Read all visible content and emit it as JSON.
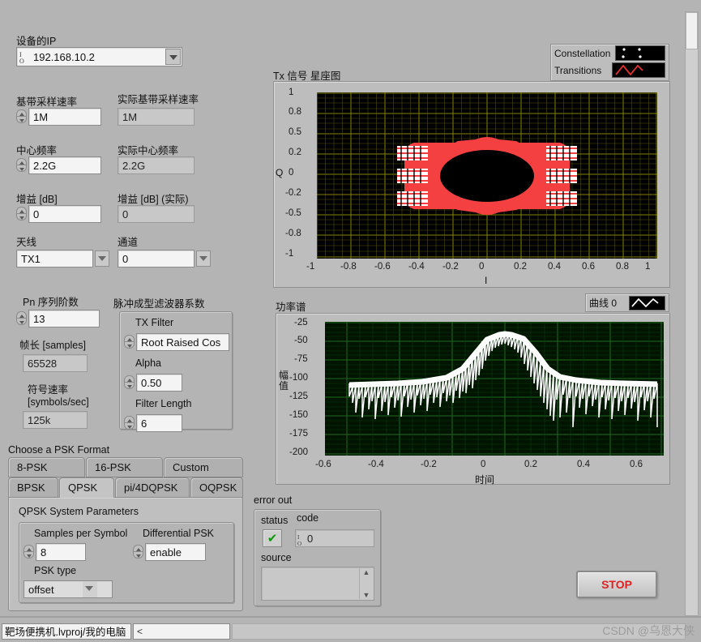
{
  "device": {
    "ip_label": "设备的IP",
    "ip_value": "192.168.10.2"
  },
  "rates": {
    "baseband_label": "基带采样速率",
    "baseband_value": "1M",
    "actual_baseband_label": "实际基带采样速率",
    "actual_baseband_value": "1M",
    "center_freq_label": "中心频率",
    "center_freq_value": "2.2G",
    "actual_center_freq_label": "实际中心频率",
    "actual_center_freq_value": "2.2G",
    "gain_label": "增益 [dB]",
    "gain_value": "0",
    "actual_gain_label": "增益 [dB] (实际)",
    "actual_gain_value": "0",
    "antenna_label": "天线",
    "antenna_value": "TX1",
    "channel_label": "通道",
    "channel_value": "0"
  },
  "pn": {
    "order_label": "Pn 序列阶数",
    "order_value": "13",
    "frame_label": "帧长 [samples]",
    "frame_value": "65528",
    "symbol_rate_label_1": "符号速率",
    "symbol_rate_label_2": "[symbols/sec]",
    "symbol_rate_value": "125k"
  },
  "pulse_shaping": {
    "group_label": "脉冲成型滤波器系数",
    "tx_filter_label": "TX Filter",
    "tx_filter_value": "Root Raised Cos",
    "alpha_label": "Alpha",
    "alpha_value": "0.50",
    "filter_length_label": "Filter Length",
    "filter_length_value": "6"
  },
  "psk": {
    "section_label": "Choose a PSK Format",
    "tabs_row1": [
      "8-PSK",
      "16-PSK",
      "Custom"
    ],
    "tabs_row2": [
      "BPSK",
      "QPSK",
      "pi/4DQPSK",
      "OQPSK"
    ],
    "active_tab": "QPSK",
    "params_title": "QPSK System Parameters",
    "samples_per_symbol_label": "Samples per Symbol",
    "samples_per_symbol_value": "8",
    "differential_label": "Differential PSK",
    "differential_value": "enable",
    "psk_type_label": "PSK type",
    "psk_type_value": "offset"
  },
  "constellation": {
    "title": "Tx 信号 星座图",
    "xlabel": "I",
    "ylabel": "Q",
    "legend": [
      {
        "name": "Constellation",
        "icon": "dots-swatch"
      },
      {
        "name": "Transitions",
        "icon": "zigzag-swatch"
      }
    ],
    "grid_color": "#8a8a00",
    "trace_color": "#f44040",
    "point_color": "#ffffff"
  },
  "spectrum": {
    "title": "功率谱",
    "xlabel": "时间",
    "ylabel": "幅值",
    "legend_label": "曲线 0",
    "grid_color": "#1f6b1f",
    "trace_color": "#ffffff"
  },
  "error_out": {
    "title": "error out",
    "status_label": "status",
    "status_icon": "check-mark",
    "code_label": "code",
    "code_value": "0",
    "source_label": "source",
    "source_value": ""
  },
  "stop": {
    "label": "STOP",
    "color": "#e02020"
  },
  "statusbar": {
    "project": "靶场便携机.lvproj/我的电脑",
    "watermark": "CSDN @乌恩大侠"
  },
  "chart_data": [
    {
      "type": "scatter",
      "title": "Tx 信号 星座图",
      "xlabel": "I",
      "ylabel": "Q",
      "xlim": [
        -1.0,
        1.0
      ],
      "ylim": [
        -1.0,
        1.0
      ],
      "xticks": [
        -1.0,
        -0.8,
        -0.6,
        -0.4,
        -0.2,
        0.0,
        0.2,
        0.4,
        0.6,
        0.8,
        1.0
      ],
      "yticks": [
        1.0,
        0.8,
        0.5,
        0.2,
        0.0,
        -0.2,
        -0.5,
        -0.8,
        -1.0
      ],
      "grid": true,
      "legend": [
        "Constellation",
        "Transitions"
      ],
      "series": [
        {
          "name": "Constellation",
          "points": [
            [
              -0.42,
              0.3
            ],
            [
              0.42,
              0.3
            ],
            [
              -0.42,
              0.0
            ],
            [
              0.42,
              0.0
            ],
            [
              -0.42,
              -0.3
            ],
            [
              0.42,
              -0.3
            ]
          ]
        },
        {
          "name": "Transitions",
          "description": "dense offset-QPSK trajectory ring between constellation clusters"
        }
      ]
    },
    {
      "type": "line",
      "title": "功率谱",
      "xlabel": "时间",
      "ylabel": "幅值",
      "xlim": [
        -0.7,
        0.7
      ],
      "ylim": [
        -200,
        -25
      ],
      "xticks": [
        -0.6,
        -0.4,
        -0.2,
        0,
        0.2,
        0.4,
        0.6
      ],
      "yticks": [
        -25,
        -50,
        -75,
        -100,
        -125,
        -150,
        -175,
        -200
      ],
      "grid": true,
      "legend": [
        "曲线 0"
      ],
      "series": [
        {
          "name": "曲线 0",
          "x": [
            -0.62,
            -0.55,
            -0.48,
            -0.4,
            -0.32,
            -0.24,
            -0.18,
            -0.13,
            -0.09,
            -0.05,
            -0.02,
            0.0,
            0.02,
            0.05,
            0.09,
            0.13,
            0.18,
            0.24,
            0.32,
            0.4,
            0.48,
            0.55,
            0.62
          ],
          "values": [
            -118,
            -118,
            -117,
            -116,
            -114,
            -110,
            -103,
            -95,
            -73,
            -60,
            -55,
            -53,
            -55,
            -60,
            -73,
            -95,
            -103,
            -110,
            -114,
            -116,
            -117,
            -118,
            -118
          ]
        }
      ]
    }
  ]
}
